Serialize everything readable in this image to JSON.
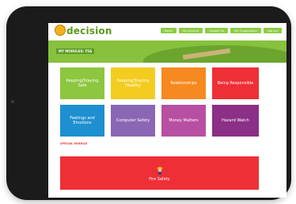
{
  "app": {
    "logo_text": "decision"
  },
  "nav": {
    "items": [
      "Home",
      "My Account",
      "Contact Us",
      "My Organisation",
      "Log out"
    ]
  },
  "banner": {
    "label": "MY MODULES: Y5A"
  },
  "modules": [
    {
      "label": "Keeping/Staying Safe",
      "color": "#8dc63f"
    },
    {
      "label": "Keeping/Staying Healthy",
      "color": "#f3cc1f"
    },
    {
      "label": "Relationships",
      "color": "#f6891f"
    },
    {
      "label": "Being Responsible",
      "color": "#ee2f36"
    },
    {
      "label": "Feelings and Emotions",
      "color": "#1e8fd0"
    },
    {
      "label": "Computer Safety",
      "color": "#8a67b4"
    },
    {
      "label": "Money Matters",
      "color": "#b74fa2"
    },
    {
      "label": "Hazard Watch",
      "color": "#8c2f86"
    }
  ],
  "special": {
    "heading": "SPECIAL MODULE",
    "module": {
      "label": "Fire Safety",
      "color": "#ee2f36",
      "icon": "fireman-icon"
    }
  }
}
